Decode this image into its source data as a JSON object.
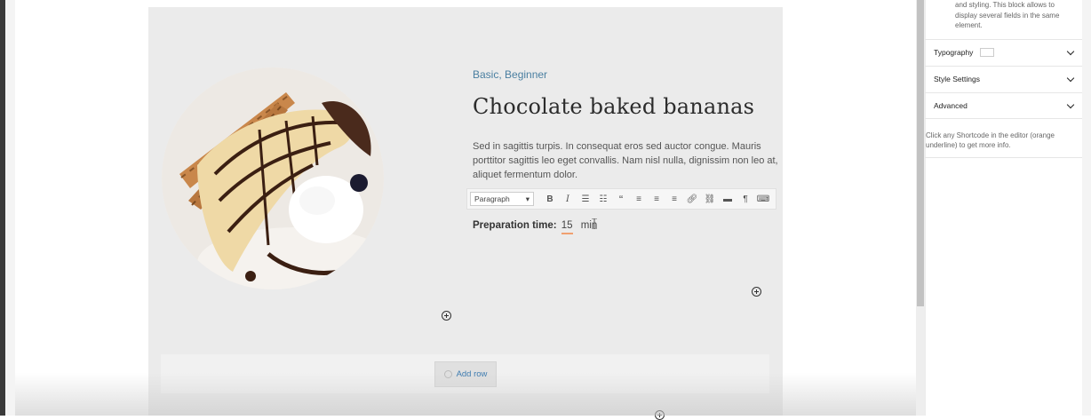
{
  "recipe": {
    "tags": "Basic, Beginner",
    "title": "Chocolate baked bananas",
    "description": "Sed in sagittis turpis. In consequat eros sed auctor congue. Mauris porttitor sagittis leo eget convallis. Nam nisl nulla, dignissim non leo at, aliquet fermentum dolor.",
    "prep_label": "Preparation time:",
    "prep_value": "15",
    "prep_unit": "min"
  },
  "toolbar": {
    "format_value": "Paragraph",
    "buttons": [
      "bold-icon",
      "italic-icon",
      "bullet-list-icon",
      "numbered-list-icon",
      "blockquote-icon",
      "align-left-icon",
      "align-center-icon",
      "align-right-icon",
      "link-icon",
      "unlink-icon",
      "insert-more-icon",
      "shortcode-icon",
      "keyboard-icon"
    ]
  },
  "builder": {
    "add_row_label": "Add row"
  },
  "sidebar": {
    "top_note": "and styling. This block allows to display several fields in the same element.",
    "panels": [
      {
        "label": "Typography"
      },
      {
        "label": "Style Settings"
      },
      {
        "label": "Advanced"
      }
    ],
    "help_text": "Click any Shortcode in the editor (orange underline) to get more info."
  },
  "colors": {
    "accent_link": "#4a7fa1",
    "shortcode_underline": "#f0a070",
    "editor_bg": "#ebebeb"
  }
}
